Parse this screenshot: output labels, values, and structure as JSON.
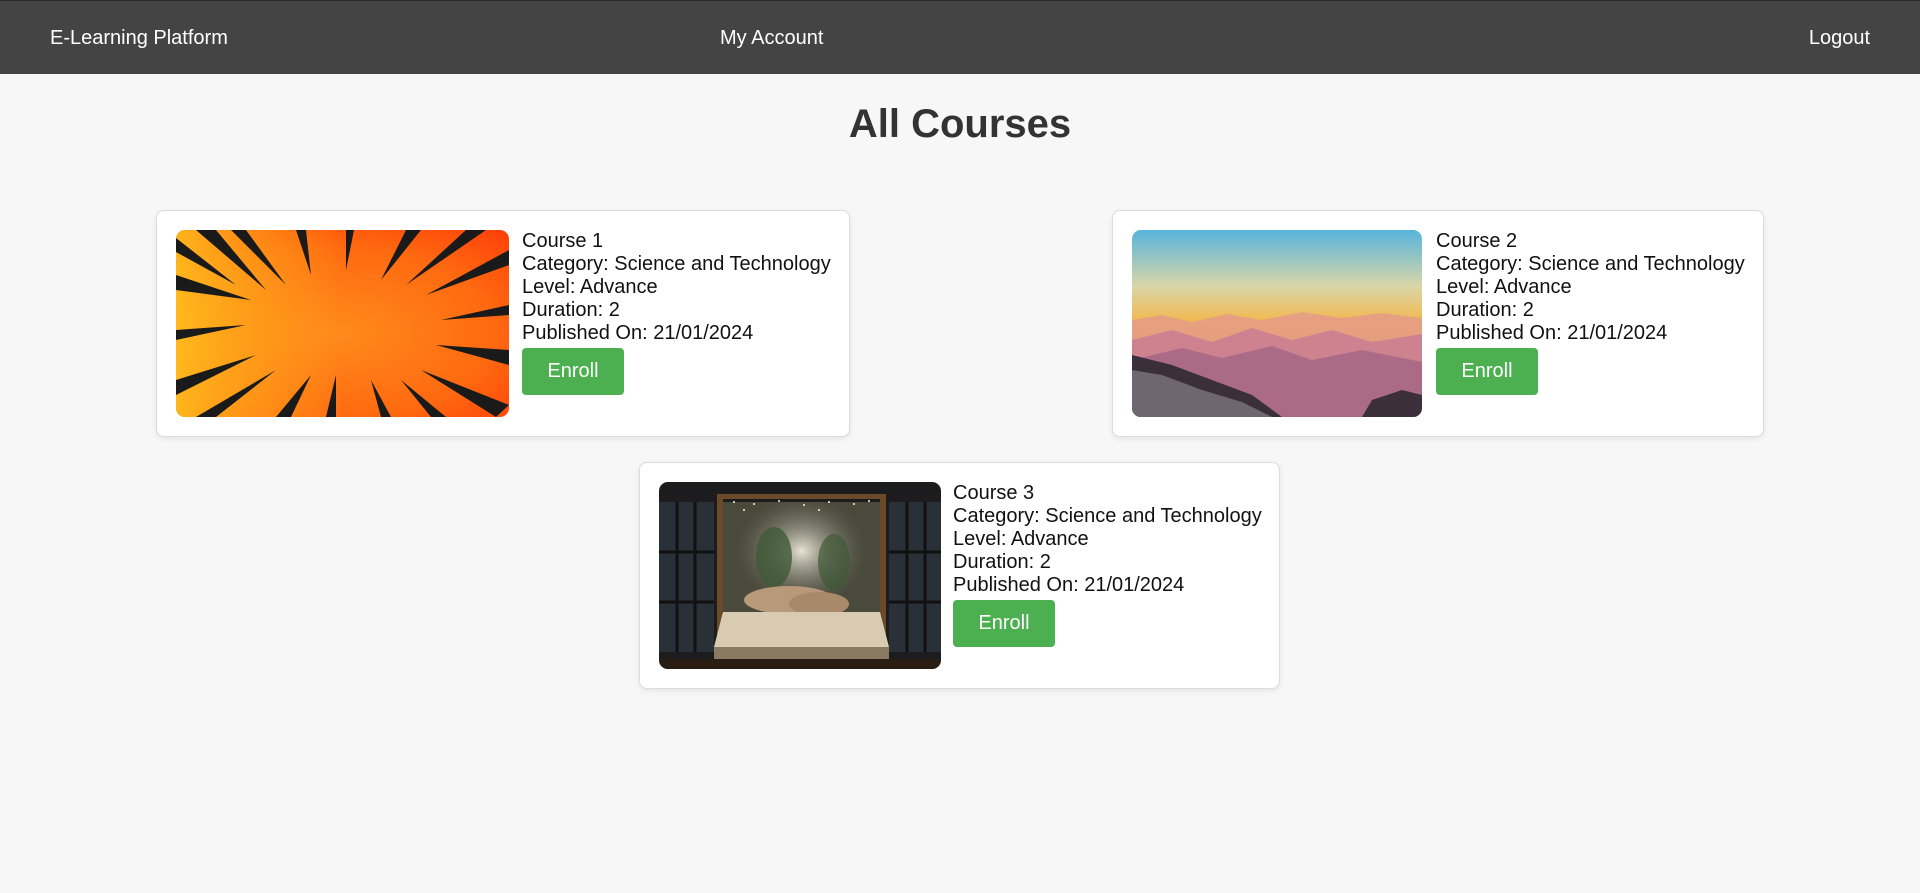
{
  "nav": {
    "brand": "E-Learning Platform",
    "account": "My Account",
    "logout": "Logout"
  },
  "page": {
    "title": "All Courses"
  },
  "courses": [
    {
      "name": "Course 1",
      "category": "Category: Science and Technology",
      "level": "Level: Advance",
      "duration": "Duration: 2",
      "published": "Published On: 21/01/2024",
      "enroll_label": "Enroll",
      "image_icon": "comic-burst-image"
    },
    {
      "name": "Course 2",
      "category": "Category: Science and Technology",
      "level": "Level: Advance",
      "duration": "Duration: 2",
      "published": "Published On: 21/01/2024",
      "enroll_label": "Enroll",
      "image_icon": "mountain-sunset-image"
    },
    {
      "name": "Course 3",
      "category": "Category: Science and Technology",
      "level": "Level: Advance",
      "duration": "Duration: 2",
      "published": "Published On: 21/01/2024",
      "enroll_label": "Enroll",
      "image_icon": "bedroom-canopy-image"
    }
  ],
  "colors": {
    "navbar": "#444444",
    "background": "#f7f7f7",
    "button": "#4caf50",
    "card": "#ffffff"
  }
}
